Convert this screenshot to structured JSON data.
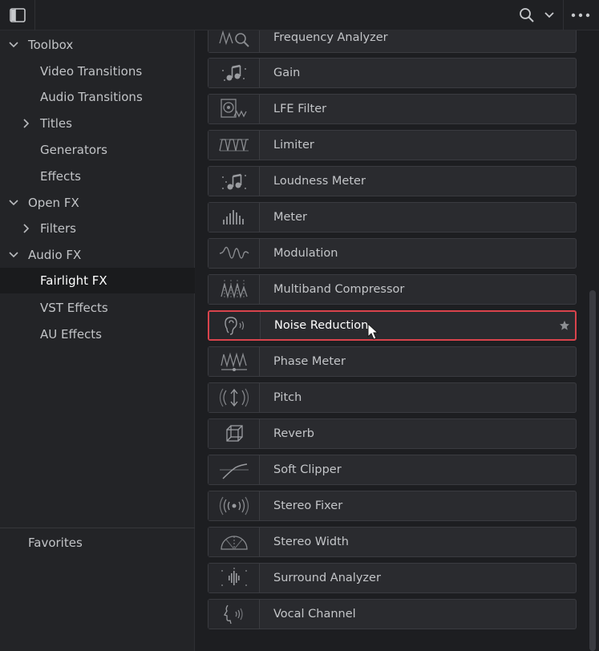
{
  "sidebar": {
    "items": [
      {
        "label": "Toolbox",
        "chevron": "chevron-down-icon"
      },
      {
        "label": "Video Transitions"
      },
      {
        "label": "Audio Transitions"
      },
      {
        "label": "Titles",
        "chevron": "chevron-right-icon"
      },
      {
        "label": "Generators"
      },
      {
        "label": "Effects"
      },
      {
        "label": "Open FX",
        "chevron": "chevron-down-icon"
      },
      {
        "label": "Filters",
        "chevron": "chevron-right-icon"
      },
      {
        "label": "Audio FX",
        "chevron": "chevron-down-icon"
      },
      {
        "label": "Fairlight FX",
        "selected": true
      },
      {
        "label": "VST Effects"
      },
      {
        "label": "AU Effects"
      }
    ],
    "favorites_label": "Favorites"
  },
  "effects": [
    {
      "name": "Frequency Analyzer",
      "icon": "frequency-analyzer-icon"
    },
    {
      "name": "Gain",
      "icon": "gain-icon"
    },
    {
      "name": "LFE Filter",
      "icon": "lfe-filter-icon"
    },
    {
      "name": "Limiter",
      "icon": "limiter-icon"
    },
    {
      "name": "Loudness Meter",
      "icon": "loudness-meter-icon"
    },
    {
      "name": "Meter",
      "icon": "meter-icon"
    },
    {
      "name": "Modulation",
      "icon": "modulation-icon"
    },
    {
      "name": "Multiband Compressor",
      "icon": "multiband-compressor-icon"
    },
    {
      "name": "Noise Reduction",
      "icon": "noise-reduction-icon",
      "selected": true
    },
    {
      "name": "Phase Meter",
      "icon": "phase-meter-icon"
    },
    {
      "name": "Pitch",
      "icon": "pitch-icon"
    },
    {
      "name": "Reverb",
      "icon": "reverb-icon"
    },
    {
      "name": "Soft Clipper",
      "icon": "soft-clipper-icon"
    },
    {
      "name": "Stereo Fixer",
      "icon": "stereo-fixer-icon"
    },
    {
      "name": "Stereo Width",
      "icon": "stereo-width-icon"
    },
    {
      "name": "Surround Analyzer",
      "icon": "surround-analyzer-icon"
    },
    {
      "name": "Vocal Channel",
      "icon": "vocal-channel-icon"
    }
  ],
  "colors": {
    "selection_border": "#d9434c",
    "background": "#1e1f22",
    "row_background": "#2a2b2f"
  }
}
